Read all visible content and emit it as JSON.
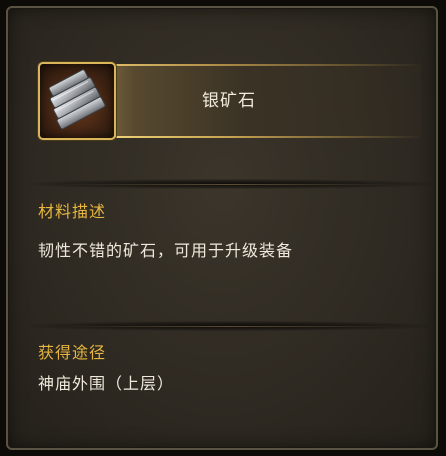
{
  "item": {
    "name": "银矿石",
    "icon": "silver-ore-icon"
  },
  "description": {
    "heading": "材料描述",
    "text": "韧性不错的矿石，可用于升级装备"
  },
  "source": {
    "heading": "获得途径",
    "text": "神庙外围（上层）"
  },
  "colors": {
    "heading": "#e6b640",
    "body_text": "#efe9dc",
    "frame_gold": "#d9b65a",
    "panel": "#2f2a22"
  }
}
